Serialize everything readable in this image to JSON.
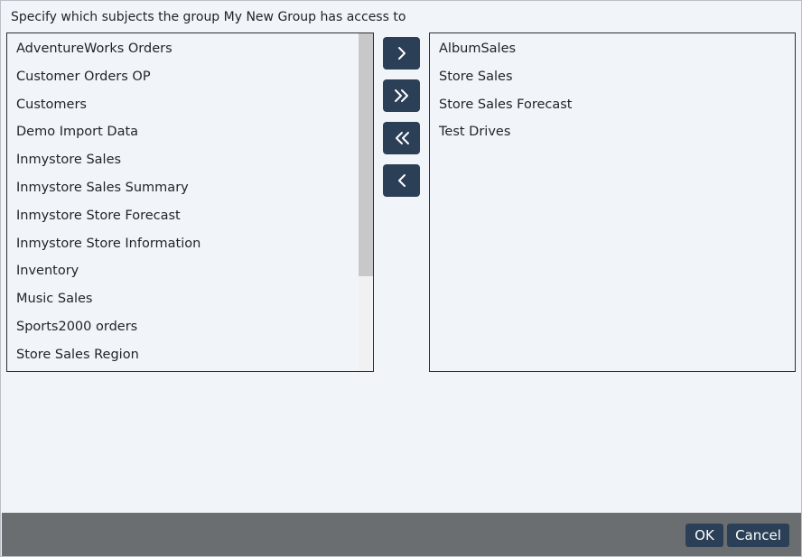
{
  "dialog": {
    "instruction": "Specify which subjects the group My New Group has access to"
  },
  "available": {
    "items": [
      "AdventureWorks Orders",
      "Customer Orders OP",
      "Customers",
      "Demo Import Data",
      "Inmystore Sales",
      "Inmystore Sales Summary",
      "Inmystore Store Forecast",
      "Inmystore Store Information",
      "Inventory",
      "Music Sales",
      "Sports2000 orders",
      "Store Sales Region"
    ]
  },
  "selected": {
    "items": [
      "AlbumSales",
      "Store Sales",
      "Store Sales Forecast",
      "Test Drives"
    ]
  },
  "move_buttons": {
    "add_one_icon": "chevron-right-icon",
    "add_all_icon": "double-chevron-right-icon",
    "remove_all_icon": "double-chevron-left-icon",
    "remove_one_icon": "chevron-left-icon"
  },
  "footer": {
    "ok_label": "OK",
    "cancel_label": "Cancel"
  },
  "colors": {
    "dialog_bg": "#f1f5f9",
    "button_bg": "#2b3f56",
    "footer_bg": "#6b6e70",
    "text": "#1f2328"
  }
}
